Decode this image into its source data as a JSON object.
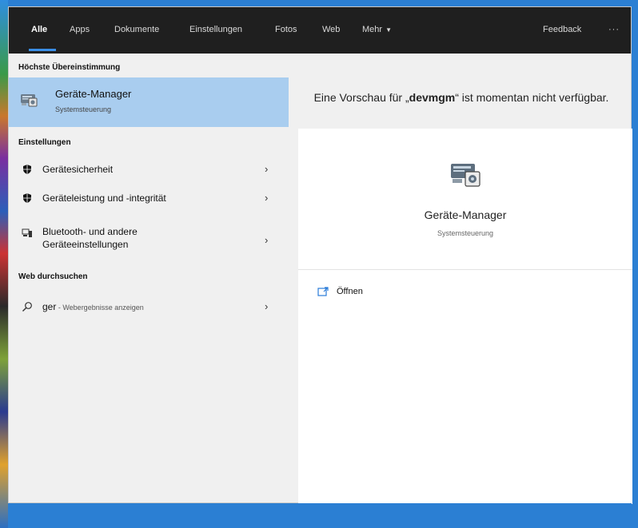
{
  "tabs": [
    {
      "label": "Alle",
      "active": true
    },
    {
      "label": "Apps"
    },
    {
      "label": "Dokumente"
    },
    {
      "label": "Einstellungen"
    },
    {
      "label": "Fotos"
    },
    {
      "label": "Web"
    },
    {
      "label": "Mehr"
    }
  ],
  "topbar": {
    "feedback": "Feedback",
    "more_dots": "···"
  },
  "best_match": {
    "heading": "Höchste Übereinstimmung",
    "title": "Geräte-Manager",
    "subtitle": "Systemsteuerung"
  },
  "settings": {
    "heading": "Einstellungen",
    "items": [
      {
        "label": "Gerätesicherheit",
        "icon": "shield-icon"
      },
      {
        "label": "Geräteleistung und -integrität",
        "icon": "shield-icon"
      },
      {
        "label_line1": "Bluetooth- und andere",
        "label_line2": "Geräteeinstellungen",
        "icon": "devices-icon"
      }
    ]
  },
  "web": {
    "heading": "Web durchsuchen",
    "query": "ger",
    "hint": " - Webergebnisse anzeigen"
  },
  "preview": {
    "msg_prefix": "Eine Vorschau für „",
    "msg_term": "devmgm",
    "msg_suffix": "“ ist momentan nicht verfügbar."
  },
  "card": {
    "title": "Geräte-Manager",
    "subtitle": "Systemsteuerung",
    "open_label": "Öffnen"
  },
  "colors": {
    "topbar": "#1f1f1f",
    "accent": "#3a8ee6",
    "selection": "#a9cdef",
    "panel": "#f0f0f0"
  }
}
